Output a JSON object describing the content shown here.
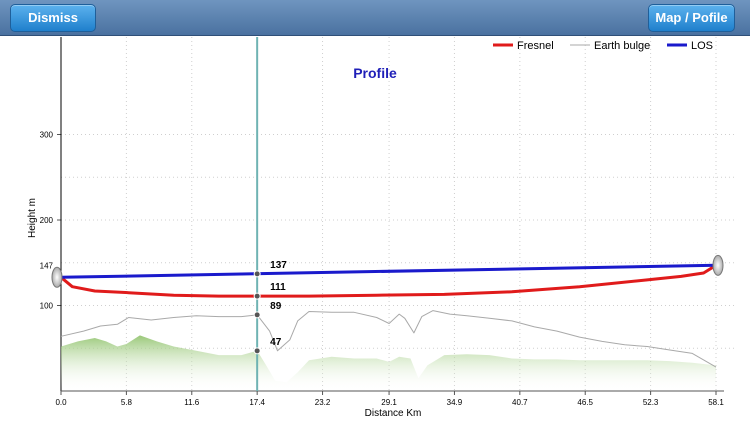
{
  "toolbar": {
    "dismiss_label": "Dismiss",
    "map_profile_label": "Map / Pofile"
  },
  "chart_data": {
    "type": "line",
    "title": "Profile",
    "xlabel": "Distance Km",
    "ylabel": "Height m",
    "xlim": [
      0,
      58.1
    ],
    "ylim": [
      0,
      360
    ],
    "x_ticks": [
      "0.0",
      "5.8",
      "11.6",
      "17.4",
      "23.2",
      "29.1",
      "34.9",
      "40.7",
      "46.5",
      "52.3",
      "58.1"
    ],
    "y_ticks": [
      100,
      200,
      300
    ],
    "marker_tick": 147,
    "grid": true,
    "legend": {
      "placement": "top-right",
      "entries": [
        "Fresnel",
        "Earth bulge",
        "LOS"
      ]
    },
    "series": [
      {
        "name": "LOS",
        "color": "#1a1acc",
        "x": [
          0,
          58.1
        ],
        "y": [
          133,
          147
        ]
      },
      {
        "name": "Fresnel",
        "color": "#e01b1b",
        "x": [
          0,
          1,
          3,
          6,
          10,
          14,
          17.4,
          22,
          28,
          34,
          40,
          46,
          52,
          55,
          57,
          58.1
        ],
        "y": [
          133,
          122,
          117,
          115,
          112,
          111,
          111,
          111,
          112,
          113,
          116,
          122,
          130,
          134,
          138,
          147
        ]
      },
      {
        "name": "Earth bulge",
        "color": "#a9a9a9",
        "x": [
          0,
          2,
          3.5,
          5,
          6,
          8,
          10,
          12,
          14,
          16,
          17.4,
          18.5,
          19.2,
          20.3,
          21,
          22,
          24,
          26,
          28,
          29.1,
          30,
          30.5,
          31.3,
          32,
          33,
          34.5,
          36,
          38,
          40,
          42,
          44,
          46,
          48,
          50,
          52,
          54,
          56,
          58.1
        ],
        "y": [
          64,
          70,
          76,
          78,
          86,
          83,
          86,
          88,
          87,
          87,
          89,
          70,
          47,
          60,
          82,
          93,
          92,
          92,
          86,
          79,
          90,
          85,
          68,
          87,
          94,
          90,
          88,
          85,
          82,
          75,
          70,
          63,
          58,
          54,
          52,
          48,
          44,
          28
        ]
      },
      {
        "name": "Terrain",
        "color": "#9cc97a",
        "x": [
          0,
          1.5,
          3,
          4,
          5,
          5.8,
          7,
          8.5,
          10,
          12,
          14,
          16,
          17.4,
          18.2,
          19,
          20,
          21,
          22,
          24,
          26,
          28,
          29.1,
          30,
          31,
          31.7,
          32.5,
          34,
          36,
          38,
          40,
          42,
          44,
          46,
          48,
          50,
          52,
          54,
          56,
          58.1
        ],
        "y": [
          52,
          58,
          62,
          58,
          52,
          55,
          65,
          58,
          52,
          47,
          42,
          42,
          47,
          30,
          12,
          10,
          22,
          36,
          40,
          38,
          38,
          34,
          40,
          38,
          15,
          30,
          42,
          43,
          42,
          38,
          37,
          37,
          36,
          36,
          36,
          36,
          35,
          33,
          30
        ]
      }
    ],
    "crosshair": {
      "x": 17.4,
      "points": [
        {
          "series": "LOS",
          "value": 137
        },
        {
          "series": "Fresnel",
          "value": 111
        },
        {
          "series": "Earth bulge",
          "value": 89
        },
        {
          "series": "Terrain",
          "value": 47
        }
      ]
    }
  }
}
